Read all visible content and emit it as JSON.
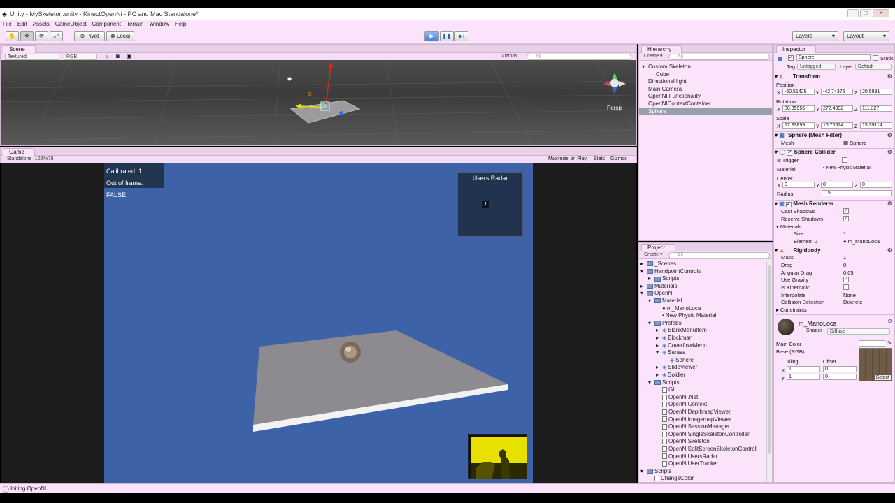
{
  "window": {
    "title": "Unity - MySkeleton.unity - KinectOpenNi - PC and Mac Standalone*"
  },
  "menu": [
    "File",
    "Edit",
    "Assets",
    "GameObject",
    "Component",
    "Terrain",
    "Window",
    "Help"
  ],
  "toolbar": {
    "pivot": "Pivot",
    "local": "Local",
    "layers": "Layers",
    "layout": "Layout"
  },
  "scene": {
    "tab": "Scene",
    "shading": "Textured",
    "rgb": "RGB",
    "gizmos": "Gizmos",
    "search": "All",
    "persp": "Persp"
  },
  "game": {
    "tab": "Game",
    "aspect": "Standalone (1024x76",
    "maximize": "Maximize on Play",
    "stats": "Stats",
    "gizmos": "Gizmos",
    "calibrated": "Calibrated: 1",
    "out_of_frame": "Out of frame: FALSE",
    "radar_title": "Users Radar",
    "radar_user": "1"
  },
  "hierarchy": {
    "tab": "Hierarchy",
    "create": "Create",
    "search": "All",
    "items": [
      {
        "label": "Custom Skeleton",
        "indent": 0,
        "arrow": true,
        "selected": false
      },
      {
        "label": "Cube",
        "indent": 1,
        "arrow": false,
        "selected": false
      },
      {
        "label": "Directional light",
        "indent": 0,
        "arrow": false,
        "selected": false
      },
      {
        "label": "Main Camera",
        "indent": 0,
        "arrow": false,
        "selected": false
      },
      {
        "label": "OpenNI Functionality",
        "indent": 0,
        "arrow": false,
        "selected": false
      },
      {
        "label": "OpenNIContextContainer",
        "indent": 0,
        "arrow": false,
        "selected": false
      },
      {
        "label": "Sphere",
        "indent": 0,
        "arrow": false,
        "selected": true
      }
    ]
  },
  "project": {
    "tab": "Project",
    "create": "Create",
    "search": "All",
    "items": [
      {
        "label": "_Scenes",
        "indent": 0,
        "type": "folder",
        "arrow": "right"
      },
      {
        "label": "HandpointControls",
        "indent": 0,
        "type": "folder",
        "arrow": "down"
      },
      {
        "label": "Scripts",
        "indent": 1,
        "type": "folder",
        "arrow": "right"
      },
      {
        "label": "Materials",
        "indent": 0,
        "type": "folder",
        "arrow": "right"
      },
      {
        "label": "OpenNI",
        "indent": 0,
        "type": "folder",
        "arrow": "down"
      },
      {
        "label": "Material",
        "indent": 1,
        "type": "folder",
        "arrow": "down"
      },
      {
        "label": "m_ManoLoca",
        "indent": 2,
        "type": "material",
        "arrow": ""
      },
      {
        "label": "New Physic Material",
        "indent": 2,
        "type": "physic",
        "arrow": ""
      },
      {
        "label": "Prefabs",
        "indent": 1,
        "type": "folder",
        "arrow": "down"
      },
      {
        "label": "BlankMenuItem",
        "indent": 2,
        "type": "prefab",
        "arrow": "right"
      },
      {
        "label": "Blockman",
        "indent": 2,
        "type": "prefab",
        "arrow": "right"
      },
      {
        "label": "CoverflowMenu",
        "indent": 2,
        "type": "prefab",
        "arrow": "right"
      },
      {
        "label": "Sarasa",
        "indent": 2,
        "type": "prefab",
        "arrow": "down"
      },
      {
        "label": "Sphere",
        "indent": 3,
        "type": "prefab",
        "arrow": ""
      },
      {
        "label": "SlideViewer",
        "indent": 2,
        "type": "prefab",
        "arrow": "right"
      },
      {
        "label": "Soldier",
        "indent": 2,
        "type": "prefab",
        "arrow": "right"
      },
      {
        "label": "Scripts",
        "indent": 1,
        "type": "folder",
        "arrow": "down"
      },
      {
        "label": "GL",
        "indent": 2,
        "type": "script",
        "arrow": ""
      },
      {
        "label": "OpenNI.Net",
        "indent": 2,
        "type": "script",
        "arrow": ""
      },
      {
        "label": "OpenNIContext",
        "indent": 2,
        "type": "script",
        "arrow": ""
      },
      {
        "label": "OpenNIDepthmapViewer",
        "indent": 2,
        "type": "script",
        "arrow": ""
      },
      {
        "label": "OpenNIImagemapViewer",
        "indent": 2,
        "type": "script",
        "arrow": ""
      },
      {
        "label": "OpenNISessionManager",
        "indent": 2,
        "type": "script",
        "arrow": ""
      },
      {
        "label": "OpenNISingleSkeletonController",
        "indent": 2,
        "type": "script",
        "arrow": ""
      },
      {
        "label": "OpenNISkeleton",
        "indent": 2,
        "type": "script",
        "arrow": ""
      },
      {
        "label": "OpenNISplitScreenSkeletonControll",
        "indent": 2,
        "type": "script",
        "arrow": ""
      },
      {
        "label": "OpenNIUsersRadar",
        "indent": 2,
        "type": "script",
        "arrow": ""
      },
      {
        "label": "OpenNIUserTracker",
        "indent": 2,
        "type": "script",
        "arrow": ""
      },
      {
        "label": "Scripts",
        "indent": 0,
        "type": "folder",
        "arrow": "down"
      },
      {
        "label": "ChangeColor",
        "indent": 1,
        "type": "script",
        "arrow": ""
      }
    ]
  },
  "inspector": {
    "tab": "Inspector",
    "name": "Sphere",
    "static": "Static",
    "tag_label": "Tag",
    "tag": "Untagged",
    "layer_label": "Layer",
    "layer": "Default",
    "transform": {
      "title": "Transform",
      "position": "Position",
      "px": "-50.51425",
      "py": "-42.74376",
      "pz": "20.5831",
      "rotation": "Rotation",
      "rx": "38.05956",
      "ry": "272.4092",
      "rz": "111.327",
      "scale": "Scale",
      "sx": "17.83899",
      "sy": "16.75524",
      "sz": "15.39114"
    },
    "meshfilter": {
      "title": "Sphere (Mesh Filter)",
      "mesh_label": "Mesh",
      "mesh": "Sphere"
    },
    "collider": {
      "title": "Sphere Collider",
      "trigger": "Is Trigger",
      "material_label": "Material",
      "material": "New Physic Material",
      "center": "Center",
      "cx": "0",
      "cy": "0",
      "cz": "0",
      "radius_label": "Radius",
      "radius": "0.5"
    },
    "renderer": {
      "title": "Mesh Renderer",
      "cast": "Cast Shadows",
      "receive": "Receive Shadows",
      "materials": "Materials",
      "size_label": "Size",
      "size": "1",
      "element_label": "Element 0",
      "element": "m_ManoLoca"
    },
    "rigidbody": {
      "title": "Rigidbody",
      "mass_label": "Mass",
      "mass": "1",
      "drag_label": "Drag",
      "drag": "0",
      "adrag_label": "Angular Drag",
      "adrag": "0.05",
      "gravity": "Use Gravity",
      "kinematic": "Is Kinematic",
      "interp_label": "Interpolate",
      "interp": "None",
      "coll_label": "Collision Detection",
      "coll": "Discrete",
      "constraints": "Constraints"
    },
    "material": {
      "name": "m_ManoLoca",
      "shader_label": "Shader",
      "shader": "Diffuse",
      "main_color": "Main Color",
      "base": "Base (RGB)",
      "tiling": "Tiling",
      "offset": "Offset",
      "x": "x",
      "y": "y",
      "tx": "1",
      "ty": "1",
      "ox": "0",
      "oy": "0",
      "select": "Select"
    }
  },
  "axis_labels": {
    "x": "X",
    "y": "Y",
    "z": "Z"
  },
  "status": {
    "text": "Initing OpenNI"
  }
}
